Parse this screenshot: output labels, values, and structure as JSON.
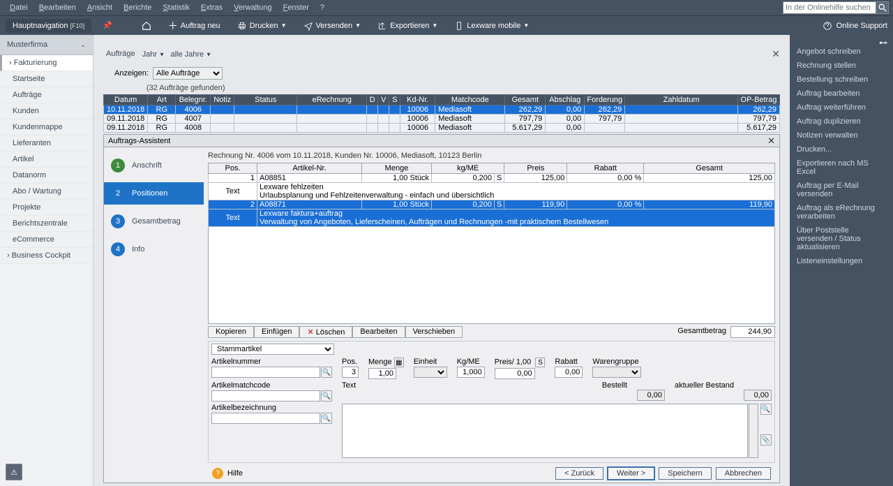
{
  "menubar": [
    "Datei",
    "Bearbeiten",
    "Ansicht",
    "Berichte",
    "Statistik",
    "Extras",
    "Verwaltung",
    "Fenster",
    "?"
  ],
  "search_placeholder": "In der Onlinehilfe suchen",
  "toolbar": {
    "nav_label": "Hauptnavigation",
    "nav_key": "[F10]",
    "home": "⌂",
    "items": [
      {
        "label": "Auftrag neu",
        "icon": "+"
      },
      {
        "label": "Drucken",
        "icon": "print",
        "caret": true
      },
      {
        "label": "Versenden",
        "icon": "send",
        "caret": true
      },
      {
        "label": "Exportieren",
        "icon": "export",
        "caret": true
      },
      {
        "label": "Lexware mobile",
        "icon": "mobile",
        "caret": true
      }
    ],
    "support": "Online Support"
  },
  "leftnav": {
    "head": "Musterfirma",
    "items": [
      {
        "label": "Fakturierung",
        "expand": true,
        "sel": true
      },
      {
        "label": "Startseite"
      },
      {
        "label": "Aufträge"
      },
      {
        "label": "Kunden"
      },
      {
        "label": "Kundenmappe"
      },
      {
        "label": "Lieferanten"
      },
      {
        "label": "Artikel"
      },
      {
        "label": "Datanorm"
      },
      {
        "label": "Abo / Wartung"
      },
      {
        "label": "Projekte"
      },
      {
        "label": "Berichtszentrale"
      },
      {
        "label": "eCommerce"
      },
      {
        "label": "Business Cockpit",
        "expand": true
      }
    ]
  },
  "title": {
    "main": "Aufträge",
    "sub1": "Jahr",
    "sub2": "alle Jahre"
  },
  "filter": {
    "label": "Anzeigen:",
    "value": "Alle Aufträge",
    "count": "(32 Aufträge gefunden)"
  },
  "ordercols": [
    "Datum",
    "Art",
    "Belegnr.",
    "Notiz",
    "Status",
    "eRechnung",
    "D",
    "V",
    "S",
    "Kd-Nr.",
    "Matchcode",
    "Gesamt",
    "Abschlag",
    "Forderung",
    "Zahldatum",
    "OP-Betrag"
  ],
  "orders": [
    {
      "datum": "10.11.2018",
      "art": "RG",
      "belegnr": "4006",
      "kdnr": "10006",
      "match": "Mediasoft",
      "gesamt": "262,29",
      "abschlag": "0,00",
      "forderung": "262,29",
      "op": "262,29",
      "sel": true
    },
    {
      "datum": "09.11.2018",
      "art": "RG",
      "belegnr": "4007",
      "kdnr": "10006",
      "match": "Mediasoft",
      "gesamt": "797,79",
      "abschlag": "0,00",
      "forderung": "797,79",
      "op": "797,79"
    },
    {
      "datum": "09.11.2018",
      "art": "RG",
      "belegnr": "4008",
      "kdnr": "10006",
      "match": "Mediasoft",
      "gesamt": "5.617,29",
      "abschlag": "0,00",
      "forderung": "",
      "op": "5.617,29"
    }
  ],
  "modal": {
    "title": "Auftrags-Assistent",
    "steps": [
      "Anschrift",
      "Positionen",
      "Gesamtbetrag",
      "Info"
    ],
    "active_step": 1,
    "bread": "Rechnung Nr. 4006 vom 10.11.2018, Kunden Nr. 10006, Mediasoft, 10123 Berlin",
    "poscols": [
      "Pos.",
      "Artikel-Nr.",
      "Menge",
      "kg/ME",
      "Preis",
      "Rabatt",
      "Gesamt"
    ],
    "pos": [
      {
        "n": "1",
        "art": "A08851",
        "menge": "1,00 Stück",
        "kg": "0,200",
        "s": "S",
        "preis": "125,00",
        "rabatt": "0,00 %",
        "ges": "125,00"
      },
      {
        "textlbl": "Text",
        "text1": "Lexware fehlzeiten",
        "text2": "Urlaubsplanung und Fehlzeitenverwaltung - einfach und übersichtlich"
      },
      {
        "n": "2",
        "art": "A08871",
        "menge": "1,00 Stück",
        "kg": "0,200",
        "s": "S",
        "preis": "119,90",
        "rabatt": "0,00 %",
        "ges": "119,90",
        "sel": true
      },
      {
        "textlbl": "Text",
        "text1": "Lexware faktura+auftrag",
        "text2": "Verwaltung von Angeboten, Lieferscheinen, Aufträgen und Rechnungen -mit praktischem Bestellwesen",
        "sel": true
      }
    ],
    "posbtns": [
      "Kopieren",
      "Einfügen",
      "Löschen",
      "Bearbeiten",
      "Verschieben"
    ],
    "total_lbl": "Gesamtbetrag",
    "total": "244,90",
    "stamm": "Stammartikel",
    "form": {
      "artikelnummer": "Artikelnummer",
      "artikelmatch": "Artikelmatchcode",
      "artikelbez": "Artikelbezeichnung",
      "pos_lbl": "Pos.",
      "pos": "3",
      "menge_lbl": "Menge",
      "menge": "1,00",
      "einheit_lbl": "Einheit",
      "einheit": "",
      "kgme_lbl": "Kg/ME",
      "kgme": "1,000",
      "preis_lbl": "Preis/ 1,00",
      "preis_unit": "S",
      "preis": "0,00",
      "rabatt_lbl": "Rabatt",
      "rabatt": "0,00",
      "wgr_lbl": "Warengruppe",
      "text_lbl": "Text",
      "bestellt_lbl": "Bestellt",
      "bestellt": "0,00",
      "bestand_lbl": "aktueller Bestand",
      "bestand": "0,00"
    },
    "help": "Hilfe",
    "buttons": {
      "back": "< Zurück",
      "next": "Weiter >",
      "save": "Speichern",
      "cancel": "Abbrechen"
    }
  },
  "rightactions": [
    "Angebot schreiben",
    "Rechnung stellen",
    "Bestellung schreiben",
    "Auftrag bearbeiten",
    "Auftrag weiterführen",
    "Auftrag duplizieren",
    "Notizen verwalten",
    "Drucken...",
    "Exportieren nach MS Excel",
    "Auftrag per E-Mail versenden",
    "Auftrag als eRechnung verarbeiten",
    "Über Poststelle versenden / Status aktualisieren",
    "Listeneinstellungen"
  ]
}
